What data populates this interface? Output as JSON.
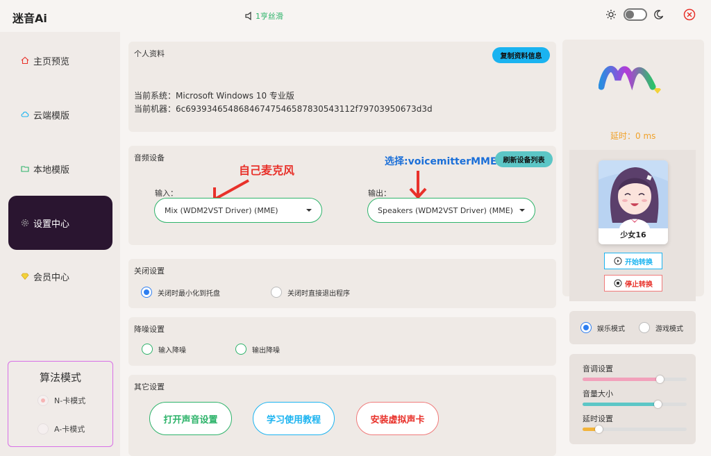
{
  "app": {
    "title": "迷音Ai",
    "notice": "1亨丝滑"
  },
  "sidebar": {
    "items": [
      {
        "label": "主页预览",
        "icon": "home-icon"
      },
      {
        "label": "云端模版",
        "icon": "cloud-icon"
      },
      {
        "label": "本地模版",
        "icon": "folder-icon"
      },
      {
        "label": "设置中心",
        "icon": "gear-icon",
        "active": true
      },
      {
        "label": "会员中心",
        "icon": "diamond-icon"
      }
    ],
    "algo": {
      "title": "算法模式",
      "options": [
        "N-卡模式",
        "A-卡模式"
      ],
      "selected": "N-卡模式"
    }
  },
  "profile": {
    "title": "个人资料",
    "copy_button": "复制资料信息",
    "system": "当前系统：Microsoft Windows 10 专业版",
    "machine": "当前机器：6c69393465486846747546587830543112f79703950673d3d"
  },
  "audio": {
    "title": "音频设备",
    "refresh_button": "刷新设备列表",
    "annot_mic": "自己麦克风",
    "annot_select": "选择:voicemitterMME",
    "input_label": "输入：",
    "input_value": "Mix (WDM2VST Driver) (MME)",
    "output_label": "输出：",
    "output_value": "Speakers (WDM2VST Driver) (MME)"
  },
  "close_settings": {
    "title": "关闭设置",
    "options": [
      "关闭时最小化到托盘",
      "关闭时直接退出程序"
    ],
    "selected": "关闭时最小化到托盘"
  },
  "noise": {
    "title": "降噪设置",
    "options": [
      "输入降噪",
      "输出降噪"
    ]
  },
  "other": {
    "title": "其它设置",
    "buttons": [
      "打开声音设置",
      "学习使用教程",
      "安装虚拟声卡"
    ]
  },
  "right": {
    "latency": "延时：0 ms",
    "avatar_name": "少女16",
    "start_button": "开始转换",
    "stop_button": "停止转换",
    "modes": [
      "娱乐模式",
      "游戏模式"
    ],
    "mode_selected": "娱乐模式",
    "sliders": [
      {
        "label": "音调设置",
        "value": 0.74,
        "color": "#f2a1bb"
      },
      {
        "label": "音量大小",
        "value": 0.72,
        "color": "#5cc6c6"
      },
      {
        "label": "延时设置",
        "value": 0.15,
        "color": "#f2b33a"
      }
    ]
  },
  "colors": {
    "accent_green": "#2db36a",
    "accent_blue": "#1ab3f0",
    "accent_red": "#e8312a",
    "active_nav": "#2a1530"
  }
}
